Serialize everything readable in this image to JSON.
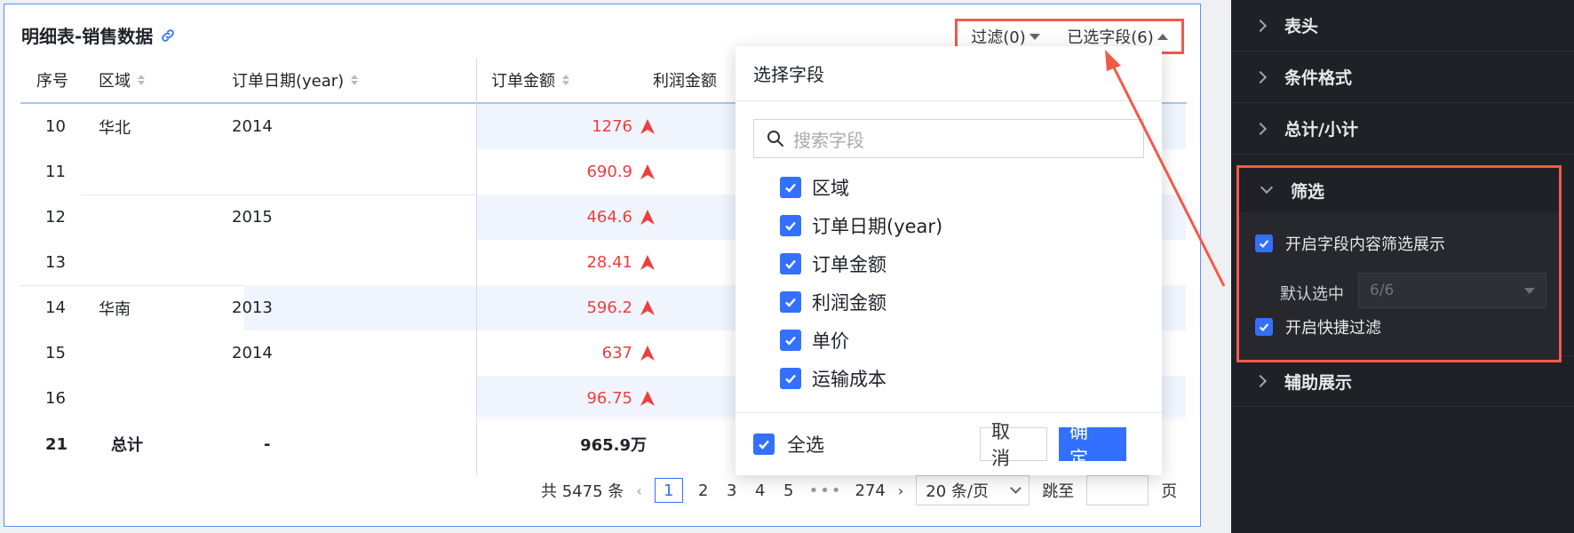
{
  "card": {
    "title": "明细表-销售数据",
    "filter_label": "过滤(0)",
    "selected_fields_label": "已选字段(6)"
  },
  "table": {
    "headers": [
      "序号",
      "区域",
      "订单日期(year)",
      "订单金额",
      "利润金额"
    ],
    "rows": [
      {
        "index": "10",
        "region": "华北",
        "year": "2014",
        "amount": "1276"
      },
      {
        "index": "11",
        "region": "",
        "year": "",
        "amount": "690.9"
      },
      {
        "index": "12",
        "region": "",
        "year": "2015",
        "amount": "464.6"
      },
      {
        "index": "13",
        "region": "",
        "year": "",
        "amount": "28.41"
      },
      {
        "index": "14",
        "region": "华南",
        "year": "2013",
        "amount": "596.2"
      },
      {
        "index": "15",
        "region": "",
        "year": "2014",
        "amount": "637"
      },
      {
        "index": "16",
        "region": "",
        "year": "",
        "amount": "96.75"
      }
    ],
    "total": {
      "index": "21",
      "label": "总计",
      "year": "-",
      "amount": "965.9万"
    }
  },
  "pager": {
    "total_text": "共 5475 条",
    "pages": [
      "1",
      "2",
      "3",
      "4",
      "5"
    ],
    "ellipsis": "•••",
    "last_page": "274",
    "page_size": "20 条/页",
    "jump_label": "跳至",
    "page_suffix": "页"
  },
  "popover": {
    "title": "选择字段",
    "search_placeholder": "搜索字段",
    "fields": [
      "区域",
      "订单日期(year)",
      "订单金额",
      "利润金额",
      "单价",
      "运输成本"
    ],
    "select_all": "全选",
    "cancel": "取 消",
    "ok": "确 定"
  },
  "panel": {
    "sections": [
      "表头",
      "条件格式",
      "总计/小计"
    ],
    "filter": {
      "title": "筛选",
      "opt_field_filter": "开启字段内容筛选展示",
      "default_label": "默认选中",
      "default_value": "6/6",
      "opt_quick_filter": "开启快捷过滤"
    },
    "aux": "辅助展示"
  },
  "colors": {
    "accent": "#3370ff",
    "highlight_red": "#f25a48",
    "amount_red": "#f03d3d",
    "panel_bg": "#1f2126"
  }
}
